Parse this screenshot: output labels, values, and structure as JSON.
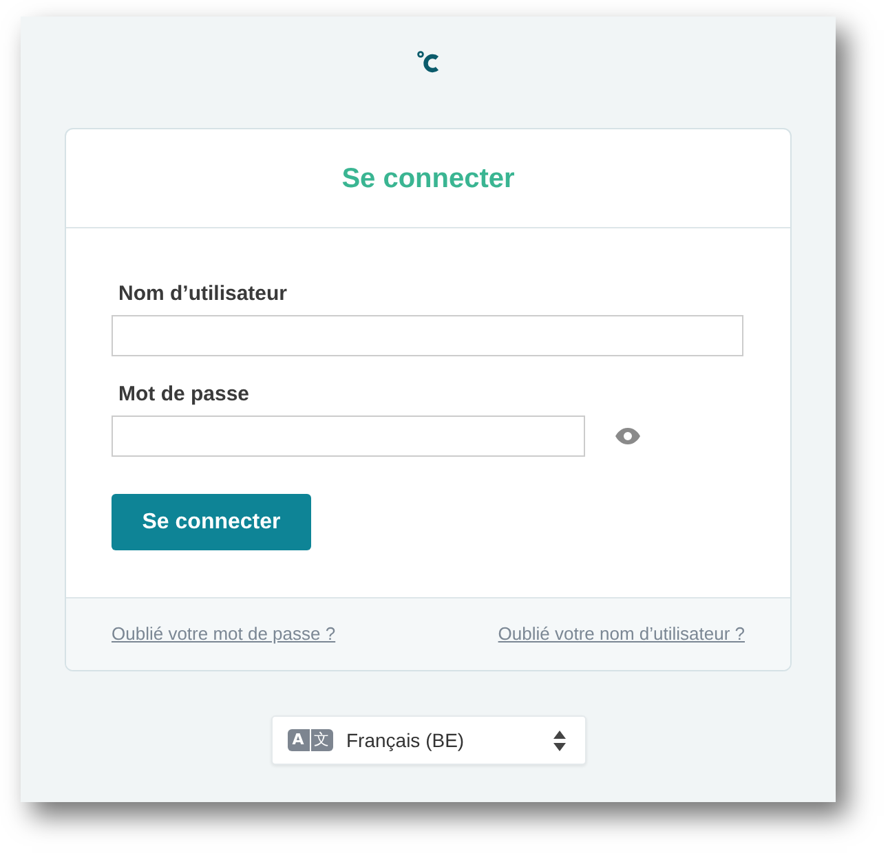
{
  "card": {
    "title": "Se connecter"
  },
  "fields": [
    {
      "label": "Nom d’utilisateur",
      "kind": "text"
    },
    {
      "label": "Mot de passe",
      "kind": "password"
    }
  ],
  "submit_button": "Se connecter",
  "links": [
    "Oublié votre mot de passe ?",
    "Oublié votre nom d’utilisateur ?"
  ],
  "language_select": {
    "icon_letters": [
      "A",
      "文"
    ],
    "value": "Français (BE)"
  }
}
